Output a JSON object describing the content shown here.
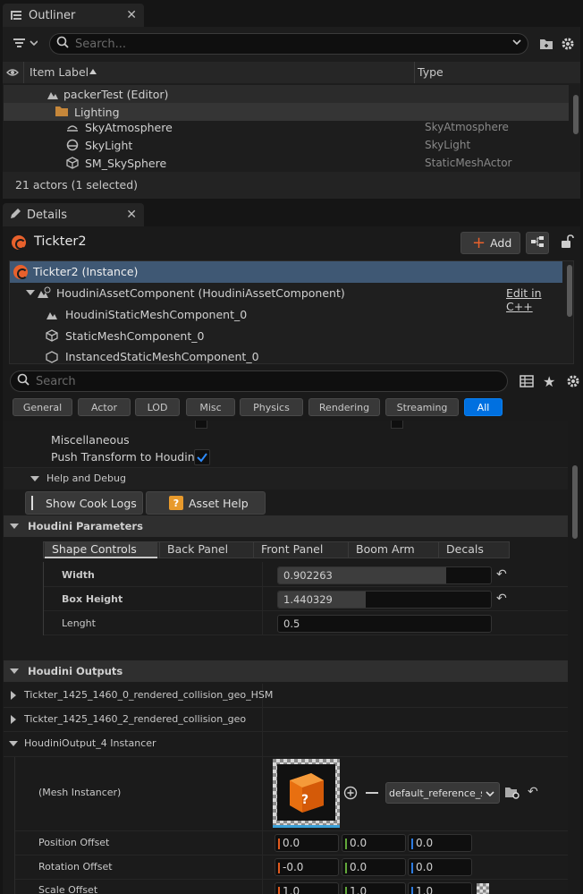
{
  "outliner": {
    "tab_title": "Outliner",
    "search_placeholder": "Search...",
    "col_label": "Item Label",
    "col_type": "Type",
    "items": [
      {
        "label": "packerTest (Editor)",
        "type": ""
      },
      {
        "label": "Lighting",
        "type": ""
      },
      {
        "label": "SkyAtmosphere",
        "type": "SkyAtmosphere"
      },
      {
        "label": "SkyLight",
        "type": "SkyLight"
      },
      {
        "label": "SM_SkySphere",
        "type": "StaticMeshActor"
      }
    ],
    "status": "21 actors (1 selected)"
  },
  "details": {
    "tab_title": "Details",
    "actor_name": "Tickter2",
    "add_label": "Add",
    "components": [
      {
        "label": "Tickter2 (Instance)"
      },
      {
        "label": "HoudiniAssetComponent (HoudiniAssetComponent)",
        "link": "Edit in C++"
      },
      {
        "label": "HoudiniStaticMeshComponent_0"
      },
      {
        "label": "StaticMeshComponent_0"
      },
      {
        "label": "InstancedStaticMeshComponent_0"
      }
    ],
    "search_placeholder": "Search",
    "filters": [
      "General",
      "Actor",
      "LOD",
      "Misc",
      "Physics",
      "Rendering",
      "Streaming",
      "All"
    ],
    "misc_label": "Miscellaneous",
    "push_transform_label": "Push Transform to Houdini",
    "help_debug_label": "Help and Debug",
    "show_cook_logs": "Show Cook Logs",
    "asset_help": "Asset Help",
    "houdini_params": {
      "title": "Houdini Parameters",
      "tabs": [
        "Shape Controls",
        "Back Panel",
        "Front Panel",
        "Boom Arm",
        "Decals"
      ],
      "params": [
        {
          "label": "Width",
          "value": "0.902263",
          "fill_pct": 79
        },
        {
          "label": "Box Height",
          "value": "1.440329",
          "fill_pct": 41
        },
        {
          "label": "Lenght",
          "value": "0.5",
          "fill_pct": 0
        }
      ]
    },
    "houdini_outputs": {
      "title": "Houdini Outputs",
      "rows": [
        "Tickter_1425_1460_0_rendered_collision_geo_HSM",
        "Tickter_1425_1460_2_rendered_collision_geo",
        "HoudiniOutput_4 Instancer"
      ],
      "mesh_instancer_label": "(Mesh Instancer)",
      "mesh_name": "default_reference_st",
      "position_label": "Position Offset",
      "rotation_label": "Rotation Offset",
      "scale_label": "Scale Offset",
      "position": [
        "0.0",
        "0.0",
        "0.0"
      ],
      "rotation": [
        "-0.0",
        "0.0",
        "0.0"
      ],
      "scale": [
        "1.0",
        "1.0",
        "1.0"
      ]
    }
  },
  "colors": {
    "accent_blue": "#0070e0",
    "selection": "#3f5874",
    "houdini_orange": "#e8612c",
    "axis_x": "#e05a1e",
    "axis_y": "#62a83a",
    "axis_z": "#2d7be0"
  }
}
